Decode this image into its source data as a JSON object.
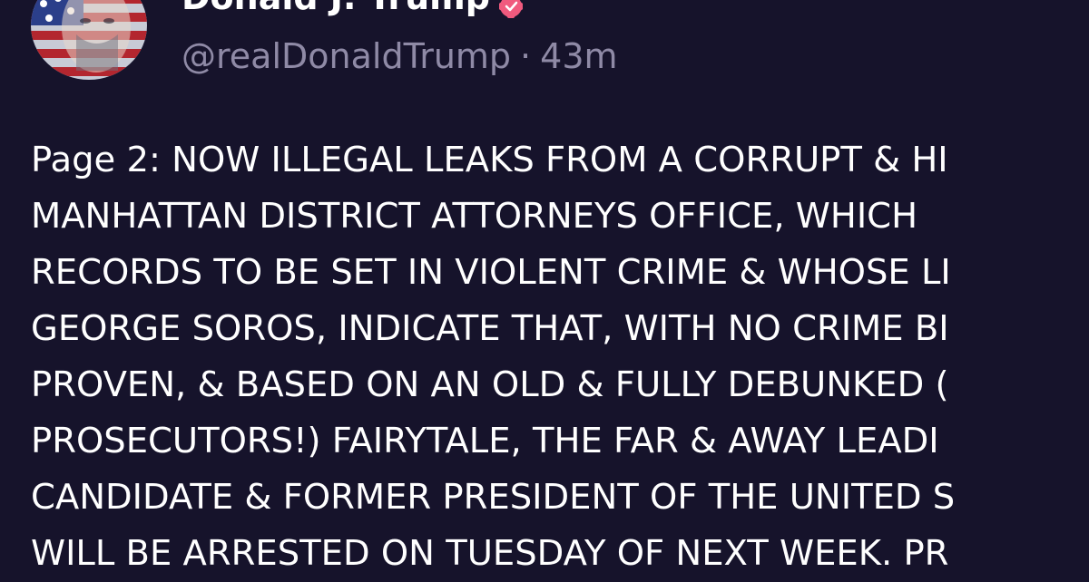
{
  "post": {
    "author": {
      "display_name": "Donald J. Trump",
      "handle": "@realDonaldTrump",
      "time_ago": "43m",
      "separator": "·"
    },
    "text_lines": [
      "Page 2: NOW ILLEGAL LEAKS FROM A CORRUPT & HI",
      "MANHATTAN DISTRICT ATTORNEYS OFFICE, WHICH",
      "RECORDS TO BE SET IN VIOLENT CRIME & WHOSE LI",
      "GEORGE SOROS, INDICATE THAT, WITH NO CRIME BI",
      "PROVEN, & BASED ON AN OLD & FULLY DEBUNKED (",
      "PROSECUTORS!) FAIRYTALE, THE FAR & AWAY LEADI",
      "CANDIDATE & FORMER PRESIDENT OF THE UNITED S",
      "WILL BE ARRESTED ON TUESDAY OF NEXT WEEK. PR"
    ]
  },
  "colors": {
    "background": "#16132b",
    "text": "#ffffff",
    "meta_text": "#8f8aa6",
    "verified_badge": "#f05a7e"
  }
}
